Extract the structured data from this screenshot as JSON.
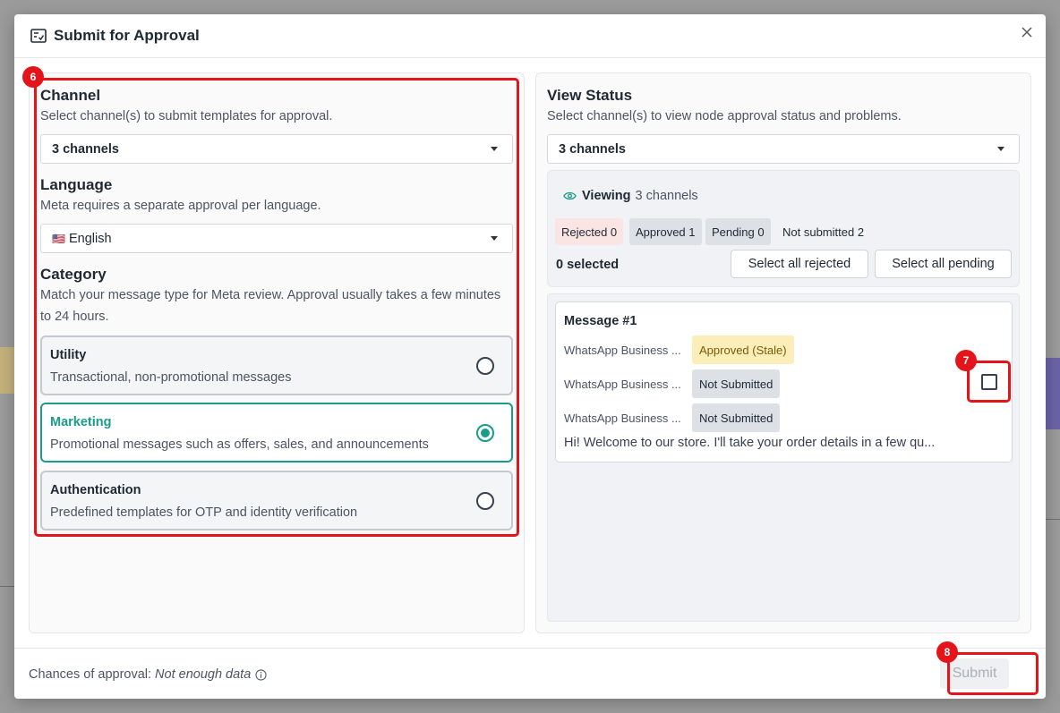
{
  "modal": {
    "title": "Submit for Approval",
    "close_label": "×"
  },
  "channel": {
    "title": "Channel",
    "description": "Select channel(s) to submit templates for approval.",
    "selected": "3 channels"
  },
  "language": {
    "title": "Language",
    "description": "Meta requires a separate approval per language.",
    "flag": "🇺🇸",
    "selected": "English"
  },
  "category": {
    "title": "Category",
    "description": "Match your message type for Meta review. Approval usually takes a few minutes to 24 hours.",
    "options": [
      {
        "title": "Utility",
        "description": "Transactional, non-promotional messages",
        "selected": false
      },
      {
        "title": "Marketing",
        "description": "Promotional messages such as offers, sales, and announcements",
        "selected": true
      },
      {
        "title": "Authentication",
        "description": "Predefined templates for OTP and identity verification",
        "selected": false
      }
    ]
  },
  "view_status": {
    "title": "View Status",
    "description": "Select channel(s) to view node approval status and problems.",
    "selected": "3 channels",
    "viewing_label": "Viewing",
    "viewing_value": "3 channels",
    "chips": {
      "rejected": "Rejected 0",
      "approved": "Approved 1",
      "pending": "Pending 0",
      "not_submitted": "Not submitted 2"
    },
    "selected_count": "0 selected",
    "select_all_rejected": "Select all rejected",
    "select_all_pending": "Select all pending",
    "message": {
      "title": "Message #1",
      "rows": [
        {
          "channel": "WhatsApp Business ...",
          "status": "Approved (Stale)"
        },
        {
          "channel": "WhatsApp Business ...",
          "status": "Not Submitted"
        },
        {
          "channel": "WhatsApp Business ...",
          "status": "Not Submitted"
        }
      ],
      "preview": "Hi! Welcome to our store. I'll take your order details in a few qu..."
    }
  },
  "footer": {
    "chances_label": "Chances of approval:",
    "chances_value": "Not enough data",
    "submit_label": "Submit"
  },
  "annotations": [
    "6",
    "7",
    "8"
  ],
  "colors": {
    "accent": "#1a9c89",
    "annotation": "#e3151a",
    "stale_bg": "#fbeeb8",
    "rejected_bg": "#fbe4e4"
  }
}
